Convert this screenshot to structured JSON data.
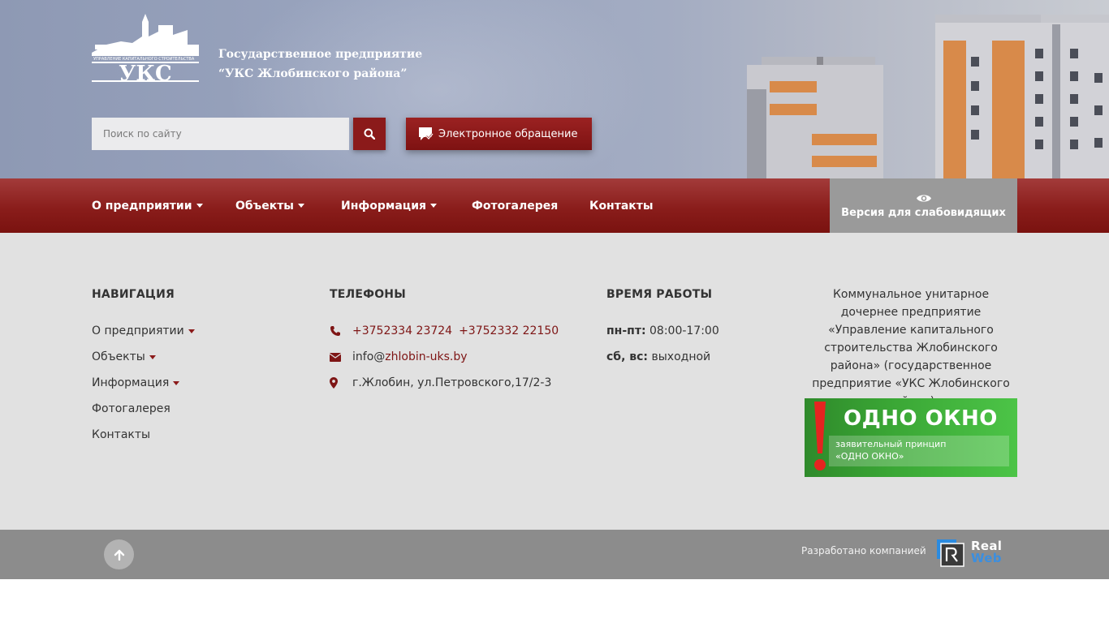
{
  "header": {
    "logo_abbr": "УКС",
    "logo_caption": "УПРАВЛЕНИЕ КАПИТАЛЬНОГО СТРОИТЕЛЬСТВА",
    "org_line1": "Государственное предприятие",
    "org_line2": "“УКС Жлобинского района”",
    "search_placeholder": "Поиск по сайту",
    "eapp_label": "Электронное обращение"
  },
  "nav": {
    "items": [
      {
        "label": "О предприятии",
        "dropdown": true
      },
      {
        "label": "Объекты",
        "dropdown": true
      },
      {
        "label": "Информация",
        "dropdown": true
      },
      {
        "label": "Фотогалерея",
        "dropdown": false
      },
      {
        "label": "Контакты",
        "dropdown": false
      }
    ],
    "vision_label": "Версия для слабовидящих"
  },
  "footer": {
    "navigation": {
      "title": "НАВИГАЦИЯ",
      "items": [
        "О предприятии",
        "Объекты",
        "Информация",
        "Фотогалерея",
        "Контакты"
      ]
    },
    "phones": {
      "title": "ТЕЛЕФОНЫ",
      "phone1": "+3752334 23724",
      "phone2": "+3752332 22150",
      "email_prefix": "info@",
      "email_domain": "zhlobin-uks.by",
      "address": "г.Жлобин, ул.Петровского,17/2-3"
    },
    "hours": {
      "title": "ВРЕМЯ РАБОТЫ",
      "weekdays_label": "пн-пт:",
      "weekdays_value": "08:00-17:00",
      "weekend_label": "сб, вс:",
      "weekend_value": "выходной"
    },
    "org_description": "Коммунальное унитарное дочернее предприятие «Управление капитального строительства Жлобинского района» (государственное предприятие «УКС Жлобинского района)",
    "banner": {
      "title": "ОДНО ОКНО",
      "sub1": "заявительный принцип",
      "sub2": "«ОДНО ОКНО»"
    }
  },
  "bottom": {
    "developed_by": "Разработано компанией",
    "dev_logo_1": "Real",
    "dev_logo_2": "Web"
  },
  "colors": {
    "accent": "#8b1a1a",
    "nav_bg": "#8a1d1b",
    "footer_bg": "#e1e1e1",
    "bottom_bg": "#8c8c8c"
  }
}
